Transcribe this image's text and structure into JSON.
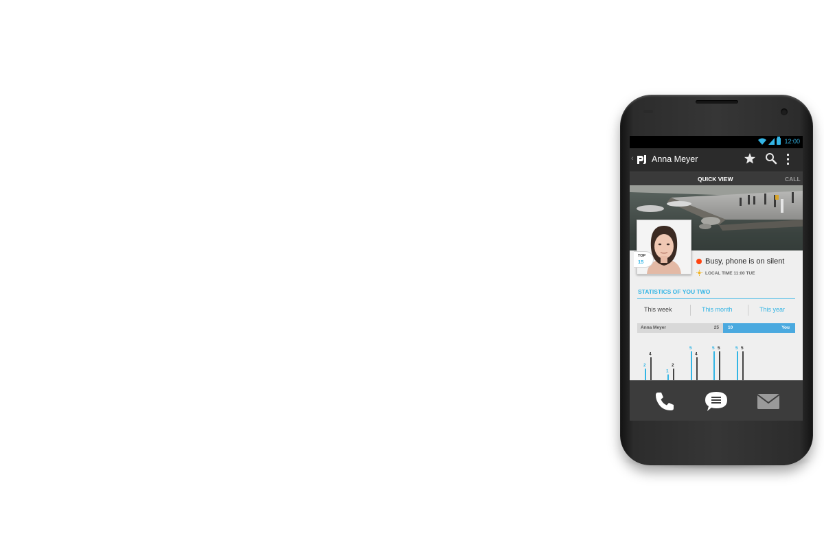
{
  "status_bar": {
    "time": "12:00"
  },
  "action_bar": {
    "title": "Anna Meyer",
    "back_icon": "chevron-left-icon",
    "logo_icon": "app-logo-icon",
    "actions": [
      "star-icon",
      "search-icon",
      "overflow-icon"
    ]
  },
  "tabs": [
    {
      "label": "QUICK VIEW"
    },
    {
      "label": "CALL"
    }
  ],
  "profile": {
    "badge_label": "TOP",
    "badge_rank": "15",
    "status_text": "Busy, phone is on silent",
    "status_color": "#ff4411",
    "local_time": "LOCAL TIME 11:00 TUE"
  },
  "stats": {
    "title": "STATISTICS OF YOU TWO",
    "periods": [
      "This week",
      "This month",
      "This year"
    ],
    "score": {
      "name": "Anna Meyer",
      "their_count": "25",
      "your_count": "10",
      "you_label": "You"
    }
  },
  "chart_data": {
    "type": "bar",
    "series": [
      {
        "color": "#33b5e5",
        "values": [
          2,
          1,
          5,
          5,
          5
        ]
      },
      {
        "color": "#444444",
        "values": [
          4,
          2,
          4,
          5,
          5
        ]
      }
    ],
    "labels_blue": [
      "2",
      "1",
      "5",
      "5",
      "5"
    ],
    "labels_dark": [
      "4",
      "2",
      "4",
      "5",
      "5"
    ]
  },
  "bottom_actions": [
    "phone-icon",
    "message-icon",
    "mail-icon"
  ],
  "colors": {
    "accent": "#33b5e5",
    "action_bar": "#2b2b2b",
    "bottom_bar": "#3c3c3c"
  }
}
